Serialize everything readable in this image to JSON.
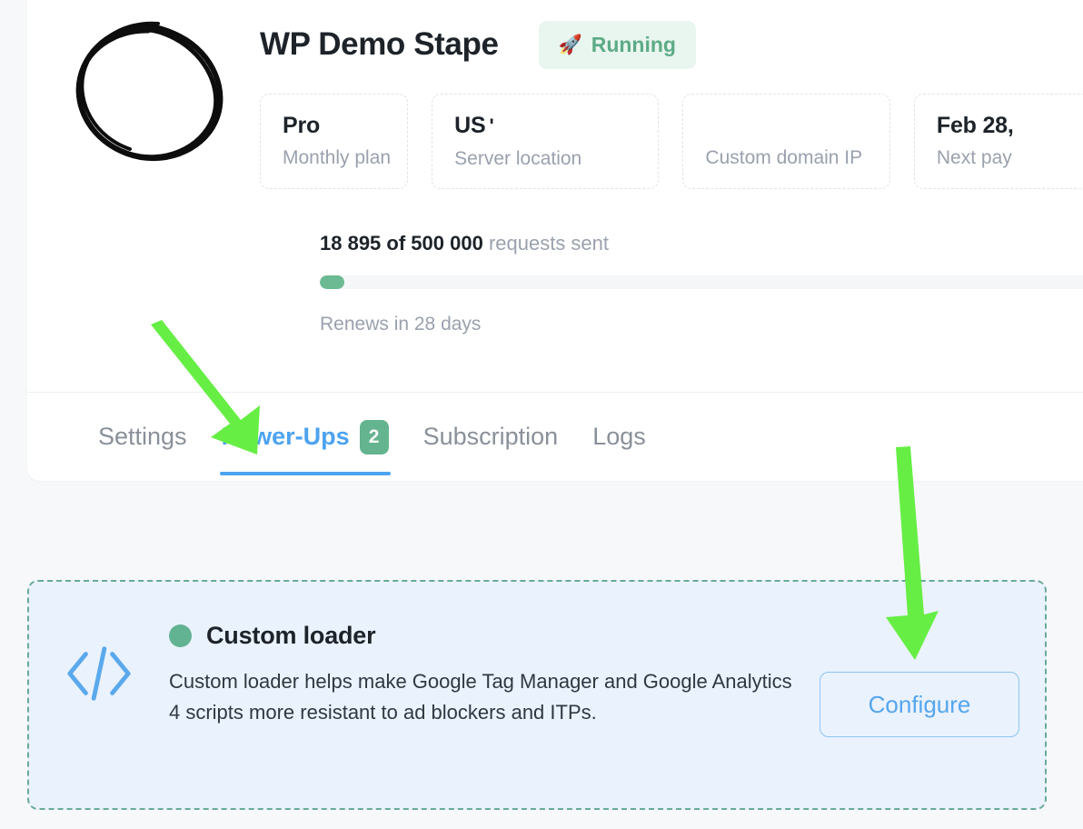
{
  "header": {
    "logo_icon": "scribble-circle-logo",
    "title": "WP Demo Stape",
    "status": {
      "icon": "rocket-emoji",
      "emoji": "🚀",
      "label": "Running",
      "text_color": "#5cab86",
      "bg_color": "#e9f5ef"
    }
  },
  "info_cards": [
    {
      "value": "Pro",
      "flag": "",
      "label": "Monthly plan"
    },
    {
      "value": "US",
      "flag": "'",
      "label": "Server location"
    },
    {
      "value": "",
      "flag": "",
      "label": "Custom domain IP"
    },
    {
      "value": "Feb 28,",
      "flag": "",
      "label": "Next pay"
    }
  ],
  "usage": {
    "used": "18 895",
    "counts_text": "18 895 of 500 000",
    "counts_suffix": "requests sent",
    "limit": "500 000",
    "percent_label": "3%",
    "percent_value": 3,
    "renew_text": "Renews in 28 days",
    "fill_color": "#6cba93",
    "track_color": "#f4f6f8"
  },
  "tabs": [
    {
      "label": "Settings",
      "active": false,
      "badge": ""
    },
    {
      "label": "Power-Ups",
      "active": true,
      "badge": "2"
    },
    {
      "label": "Subscription",
      "active": false,
      "badge": ""
    },
    {
      "label": "Logs",
      "active": false,
      "badge": ""
    }
  ],
  "powerup": {
    "icon": "code-brackets-icon",
    "status_dot_color": "#62b391",
    "title": "Custom loader",
    "description": "Custom loader helps make Google Tag Manager and Google Analytics 4 scripts more resistant to ad blockers and ITPs.",
    "button_label": "Configure",
    "accent_color": "#54a6ef",
    "card_bg": "#eaf2fd",
    "card_border": "#68ab97"
  },
  "annotations": {
    "arrow_color": "#66ee44",
    "arrow_1_target": "Power-Ups tab",
    "arrow_2_target": "Configure button"
  }
}
